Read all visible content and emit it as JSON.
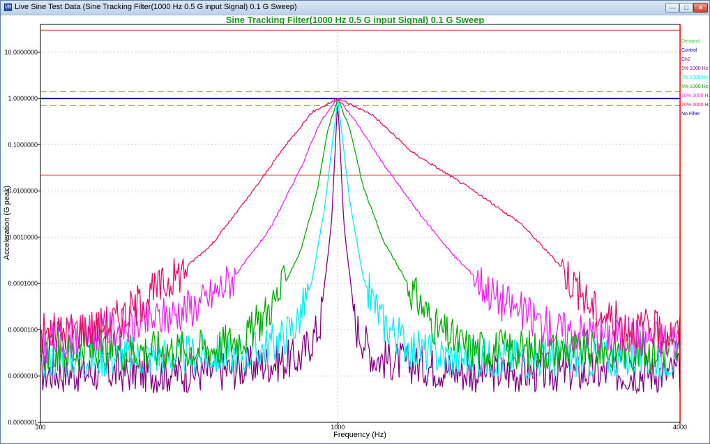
{
  "window": {
    "title": "Live Sine Test Data (Sine Tracking Filter(1000 Hz 0.5 G input Signal) 0.1 G Sweep)",
    "app_icon_text": "VR",
    "controls": [
      "minimize-icon",
      "maximize-icon",
      "close-icon"
    ]
  },
  "chart_data": {
    "type": "line",
    "title": "Sine Tracking Filter(1000 Hz 0.5 G input Signal) 0.1 G Sweep",
    "xlabel": "Frequency (Hz)",
    "ylabel": "Acceleration (G peak)",
    "x_scale": "log",
    "y_scale": "log",
    "xlim": [
      300,
      4000
    ],
    "ylim": [
      1e-07,
      40
    ],
    "x_ticks": [
      {
        "value": 300,
        "label": "300"
      },
      {
        "value": 1000,
        "label": "1000"
      },
      {
        "value": 4000,
        "label": "4000"
      }
    ],
    "y_ticks": [
      {
        "value": 10,
        "label": "10.0000000"
      },
      {
        "value": 1,
        "label": "1.0000000"
      },
      {
        "value": 0.1,
        "label": "0.1000000"
      },
      {
        "value": 0.01,
        "label": "0.0100000"
      },
      {
        "value": 0.001,
        "label": "0.0010000"
      },
      {
        "value": 0.0001,
        "label": "0.0001000"
      },
      {
        "value": 1e-05,
        "label": "0.0000100"
      },
      {
        "value": 1e-06,
        "label": "0.0000010"
      },
      {
        "value": 1e-07,
        "label": "0.0000001"
      }
    ],
    "grid": true,
    "legend_position": "right",
    "reference_lines": [
      {
        "name": "Demand",
        "value": 1.0,
        "color": "#9fd35a",
        "style": "solid"
      },
      {
        "name": "Control",
        "value": 1.0,
        "color": "#0000aa",
        "style": "solid"
      },
      {
        "name": "upper-abort",
        "value": 30,
        "color": "#ee3333",
        "style": "solid"
      },
      {
        "name": "lower-abort",
        "value": 0.022,
        "color": "#ee3333",
        "style": "solid"
      },
      {
        "name": "upper-alarm",
        "value": 1.4,
        "color": "#8c8c1e",
        "style": "dashed"
      },
      {
        "name": "lower-alarm",
        "value": 0.7,
        "color": "#8c8c1e",
        "style": "dashed"
      }
    ],
    "series": [
      {
        "name": "Demand",
        "color": "#33cc33",
        "values": [
          [
            300,
            1.0
          ],
          [
            4000,
            1.0
          ]
        ]
      },
      {
        "name": "Control",
        "color": "#0000cc",
        "values": [
          [
            300,
            1.0
          ],
          [
            4000,
            1.0
          ]
        ]
      },
      {
        "name": "Ch2",
        "color": "#800080",
        "values": []
      },
      {
        "name": "1% 1000 Hz",
        "color": "#800080",
        "noise_floor": 1.2e-06,
        "values": [
          [
            300,
            1.2e-06
          ],
          [
            600,
            1.2e-06
          ],
          [
            860,
            2.5e-06
          ],
          [
            930,
            1.2e-05
          ],
          [
            975,
            0.002
          ],
          [
            1000,
            1.0
          ],
          [
            1025,
            0.002
          ],
          [
            1075,
            1.2e-05
          ],
          [
            1160,
            2.5e-06
          ],
          [
            1700,
            1.2e-06
          ],
          [
            4000,
            1.2e-06
          ]
        ]
      },
      {
        "name": "1% 1000 Hz",
        "color": "#00eeee",
        "noise_floor": 2.5e-06,
        "values": [
          [
            300,
            2.5e-06
          ],
          [
            700,
            3e-06
          ],
          [
            790,
            6e-06
          ],
          [
            850,
            1.5e-05
          ],
          [
            900,
            0.0001
          ],
          [
            950,
            0.005
          ],
          [
            1000,
            1.0
          ],
          [
            1050,
            0.006
          ],
          [
            1110,
            0.00012
          ],
          [
            1200,
            1.5e-05
          ],
          [
            1350,
            4e-06
          ],
          [
            1600,
            2.5e-06
          ],
          [
            4000,
            2.5e-06
          ]
        ]
      },
      {
        "name": "5% 1000 Hz",
        "color": "#00aa00",
        "noise_floor": 3.5e-06,
        "values": [
          [
            300,
            3.5e-06
          ],
          [
            600,
            4e-06
          ],
          [
            700,
            8e-06
          ],
          [
            790,
            6e-05
          ],
          [
            860,
            0.0005
          ],
          [
            920,
            0.01
          ],
          [
            960,
            0.2
          ],
          [
            1000,
            1.0
          ],
          [
            1050,
            0.22
          ],
          [
            1110,
            0.012
          ],
          [
            1200,
            0.0009
          ],
          [
            1350,
            7e-05
          ],
          [
            1500,
            1e-05
          ],
          [
            1700,
            4e-06
          ],
          [
            4000,
            3.5e-06
          ]
        ]
      },
      {
        "name": "10% 1000 Hz",
        "color": "#ee22ee",
        "noise_floor": 5e-06,
        "values": [
          [
            300,
            5e-06
          ],
          [
            430,
            1.2e-05
          ],
          [
            500,
            2e-05
          ],
          [
            580,
            4e-05
          ],
          [
            660,
            0.00015
          ],
          [
            760,
            0.0015
          ],
          [
            860,
            0.03
          ],
          [
            930,
            0.3
          ],
          [
            1000,
            1.0
          ],
          [
            1080,
            0.3
          ],
          [
            1200,
            0.04
          ],
          [
            1400,
            0.003
          ],
          [
            1600,
            0.0004
          ],
          [
            1900,
            5e-05
          ],
          [
            2400,
            1e-05
          ],
          [
            4000,
            6e-06
          ]
        ]
      },
      {
        "name": "20% 1000 Hz",
        "color": "#e0106e",
        "noise_floor": 8e-06,
        "values": [
          [
            300,
            8e-06
          ],
          [
            380,
            1.2e-05
          ],
          [
            420,
            2e-05
          ],
          [
            460,
            5e-05
          ],
          [
            520,
            0.00015
          ],
          [
            600,
            0.0007
          ],
          [
            700,
            0.008
          ],
          [
            800,
            0.08
          ],
          [
            900,
            0.5
          ],
          [
            1000,
            1.0
          ],
          [
            1150,
            0.45
          ],
          [
            1350,
            0.07
          ],
          [
            1700,
            0.012
          ],
          [
            2100,
            0.002
          ],
          [
            2500,
            0.0002
          ],
          [
            2800,
            3e-05
          ],
          [
            3200,
            1.2e-05
          ],
          [
            4000,
            8e-06
          ]
        ]
      },
      {
        "name": "No Filter",
        "color": "#00008b",
        "values": []
      }
    ]
  }
}
